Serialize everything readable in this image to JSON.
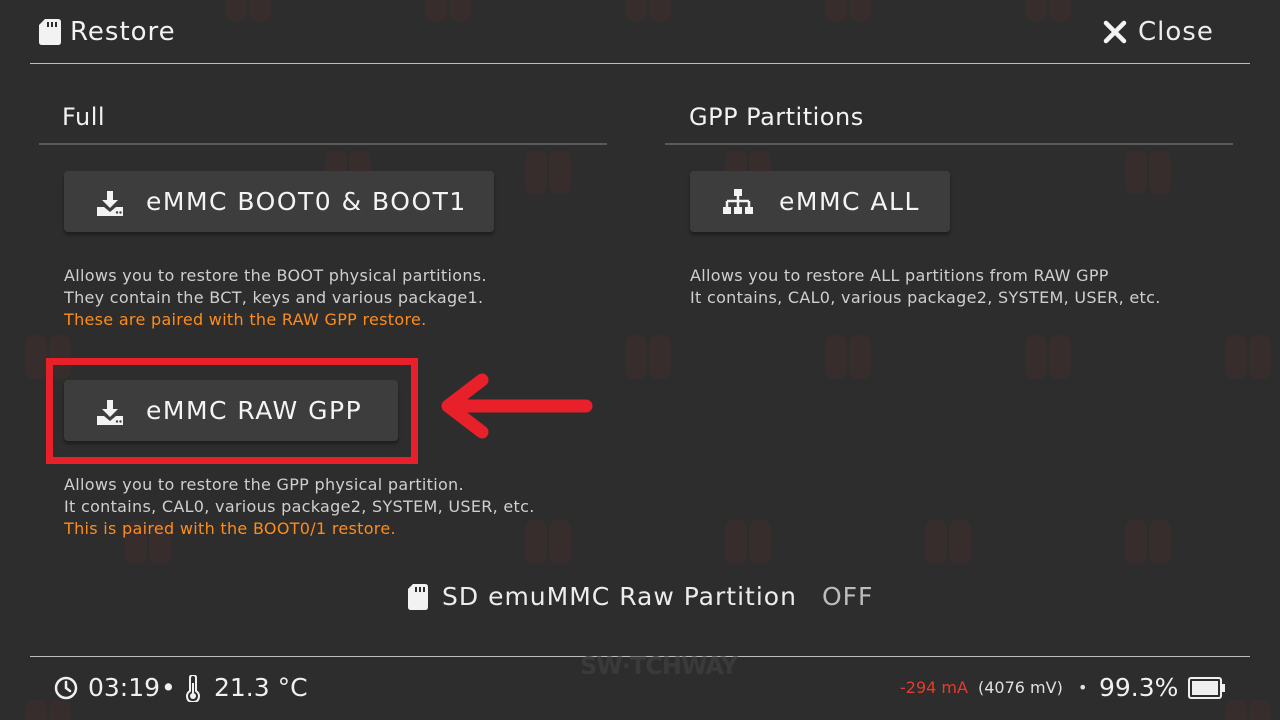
{
  "header": {
    "title": "Restore",
    "close_label": "Close"
  },
  "sections": {
    "full": {
      "heading": "Full",
      "boot_button": "eMMC BOOT0 & BOOT1",
      "boot_desc_1": "Allows you to restore the BOOT physical partitions.",
      "boot_desc_2": "They contain the BCT, keys and various package1.",
      "boot_desc_warn": "These are paired with the RAW GPP restore.",
      "raw_button": "eMMC RAW GPP",
      "raw_desc_1": "Allows you to restore the GPP physical partition.",
      "raw_desc_2": "It contains, CAL0, various package2, SYSTEM, USER, etc.",
      "raw_desc_warn": "This is paired with the BOOT0/1 restore."
    },
    "gpp": {
      "heading": "GPP Partitions",
      "all_button": "eMMC ALL",
      "all_desc_1": "Allows you to restore ALL partitions from RAW GPP",
      "all_desc_2": "It contains, CAL0, various package2, SYSTEM, USER, etc."
    }
  },
  "toggle": {
    "label": "SD emuMMC Raw Partition",
    "value": "OFF"
  },
  "footer": {
    "time": "03:19",
    "temperature": "21.3 °C",
    "current": "-294 mA",
    "voltage": "(4076 mV)",
    "battery": "99.3%",
    "separator": "•"
  },
  "branding": "SW·TCHWAY",
  "colors": {
    "background": "#2d2d2d",
    "button": "#3d3d3d",
    "warning": "#ff8c1a",
    "highlight": "#e8202a",
    "current": "#e63b2e"
  },
  "icons": {
    "header": "sd-card-icon",
    "close": "close-icon",
    "boot_button": "download-icon",
    "raw_button": "download-icon",
    "all_button": "sitemap-icon",
    "toggle": "sd-card-icon",
    "clock": "clock-icon",
    "thermometer": "thermometer-icon",
    "battery": "battery-icon"
  }
}
